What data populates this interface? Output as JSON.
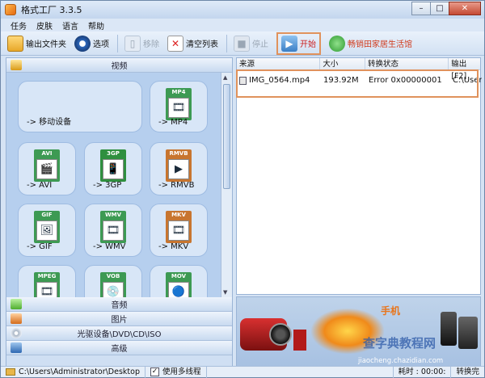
{
  "window": {
    "title": "格式工厂 3.3.5",
    "min": "–",
    "max": "□",
    "close": "✕"
  },
  "menu": [
    "任务",
    "皮肤",
    "语言",
    "帮助"
  ],
  "toolbar": {
    "output_folder": "输出文件夹",
    "options": "选项",
    "remove": "移除",
    "clear_list": "清空列表",
    "stop": "停止",
    "start": "开始",
    "extra": "畅销田家居生活馆"
  },
  "categories": {
    "video": "视频",
    "audio": "音频",
    "picture": "图片",
    "rom": "光驱设备\\DVD\\CD\\ISO",
    "advanced": "高级"
  },
  "video_tiles": [
    {
      "label": "-> 移动设备",
      "tag": ""
    },
    {
      "label": "-> MP4",
      "tag": "MP4"
    },
    {
      "label": "-> AVI",
      "tag": "AVI"
    },
    {
      "label": "-> 3GP",
      "tag": "3GP"
    },
    {
      "label": "-> RMVB",
      "tag": "RMVB"
    },
    {
      "label": "-> GIF",
      "tag": "GIF"
    },
    {
      "label": "-> WMV",
      "tag": "WMV"
    },
    {
      "label": "-> MKV",
      "tag": "MKV"
    },
    {
      "label": "",
      "tag": "MPEG"
    },
    {
      "label": "",
      "tag": "VOB"
    },
    {
      "label": "",
      "tag": "MOV"
    }
  ],
  "task_list": {
    "columns": [
      "来源",
      "大小",
      "转换状态",
      "输出 [F2]"
    ],
    "rows": [
      {
        "source": "IMG_0564.mp4",
        "size": "193.92M",
        "status": "Error 0x00000001",
        "output": "C:\\Users"
      }
    ]
  },
  "statusbar": {
    "output_path": "C:\\Users\\Administrator\\Desktop",
    "multithread_checked": "✓",
    "multithread": "使用多线程",
    "elapsed_label": "耗时 : 00:00:",
    "after_convert": "转换完"
  },
  "banner": {
    "brand": "手机",
    "watermark": "查字典教程网",
    "url": "jiaocheng.chazidian.com"
  },
  "colors": {
    "accent": "#e0925c",
    "panel": "#cfdff3",
    "tile": "#d8e6f7"
  }
}
